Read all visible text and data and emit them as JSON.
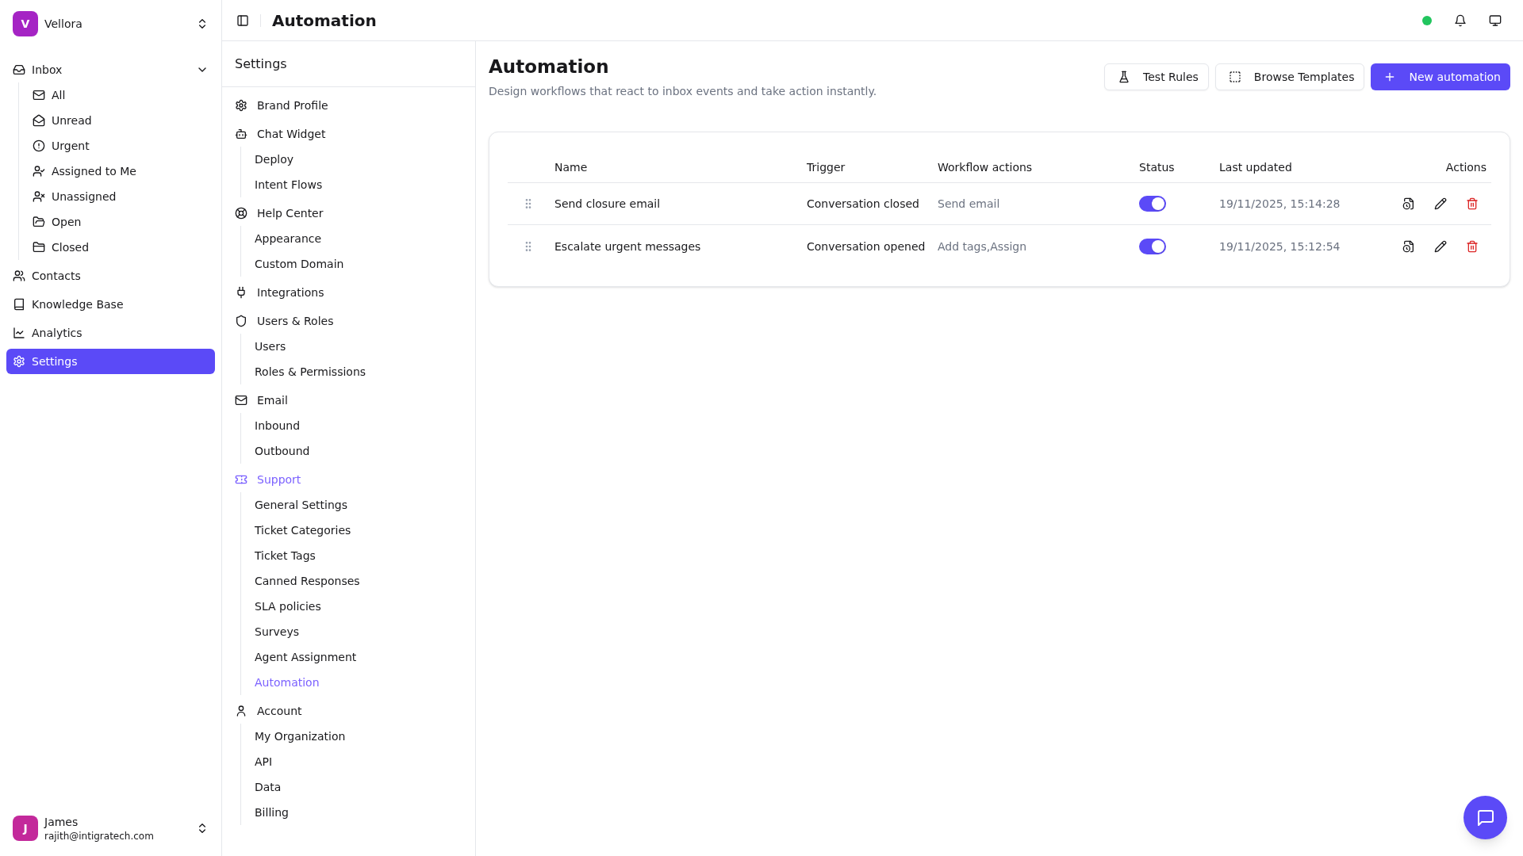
{
  "workspace": {
    "initial": "V",
    "name": "Vellora"
  },
  "nav": [
    {
      "label": "Inbox",
      "selected": false,
      "expanded": true,
      "children": [
        {
          "label": "All",
          "selected": false
        },
        {
          "label": "Unread",
          "selected": false
        },
        {
          "label": "Urgent",
          "selected": false
        },
        {
          "label": "Assigned to Me",
          "selected": false
        },
        {
          "label": "Unassigned",
          "selected": false
        },
        {
          "label": "Open",
          "selected": false
        },
        {
          "label": "Closed",
          "selected": false
        }
      ]
    },
    {
      "label": "Contacts",
      "selected": false
    },
    {
      "label": "Knowledge Base",
      "selected": false
    },
    {
      "label": "Analytics",
      "selected": false
    },
    {
      "label": "Settings",
      "selected": true
    }
  ],
  "user": {
    "initial": "J",
    "name": "James",
    "email": "rajith@intigratech.com"
  },
  "header": {
    "title": "Automation",
    "online": true
  },
  "settings_nav": {
    "title": "Settings",
    "groups": [
      {
        "label": "Brand Profile",
        "selected": false
      },
      {
        "label": "Chat Widget",
        "selected": false,
        "children": [
          {
            "label": "Deploy",
            "selected": false
          },
          {
            "label": "Intent Flows",
            "selected": false
          }
        ]
      },
      {
        "label": "Help Center",
        "selected": false,
        "children": [
          {
            "label": "Appearance",
            "selected": false
          },
          {
            "label": "Custom Domain",
            "selected": false
          }
        ]
      },
      {
        "label": "Integrations",
        "selected": false
      },
      {
        "label": "Users & Roles",
        "selected": false,
        "children": [
          {
            "label": "Users",
            "selected": false
          },
          {
            "label": "Roles & Permissions",
            "selected": false
          }
        ]
      },
      {
        "label": "Email",
        "selected": false,
        "children": [
          {
            "label": "Inbound",
            "selected": false
          },
          {
            "label": "Outbound",
            "selected": false
          }
        ]
      },
      {
        "label": "Support",
        "selected": true,
        "children": [
          {
            "label": "General Settings",
            "selected": false
          },
          {
            "label": "Ticket Categories",
            "selected": false
          },
          {
            "label": "Ticket Tags",
            "selected": false
          },
          {
            "label": "Canned Responses",
            "selected": false
          },
          {
            "label": "SLA policies",
            "selected": false
          },
          {
            "label": "Surveys",
            "selected": false
          },
          {
            "label": "Agent Assignment",
            "selected": false
          },
          {
            "label": "Automation",
            "selected": true
          }
        ]
      },
      {
        "label": "Account",
        "selected": false,
        "children": [
          {
            "label": "My Organization",
            "selected": false
          },
          {
            "label": "API",
            "selected": false
          },
          {
            "label": "Data",
            "selected": false
          },
          {
            "label": "Billing",
            "selected": false
          }
        ]
      }
    ]
  },
  "page": {
    "title": "Automation",
    "description": "Design workflows that react to inbox events and take action instantly.",
    "buttons": [
      {
        "label": "Test Rules",
        "kind": "outline"
      },
      {
        "label": "Browse Templates",
        "kind": "outline"
      },
      {
        "label": "New automation",
        "kind": "primary"
      }
    ]
  },
  "table": {
    "columns": [
      "Name",
      "Trigger",
      "Workflow actions",
      "Status",
      "Last updated",
      "Actions"
    ],
    "rows": [
      {
        "name": "Send closure email",
        "trigger": "Conversation closed",
        "workflow_actions": "Send email",
        "enabled": true,
        "last_updated": "19/11/2025, 15:14:28"
      },
      {
        "name": "Escalate urgent messages",
        "trigger": "Conversation opened",
        "workflow_actions": "Add tags,Assign",
        "enabled": true,
        "last_updated": "19/11/2025, 15:12:54"
      }
    ]
  }
}
